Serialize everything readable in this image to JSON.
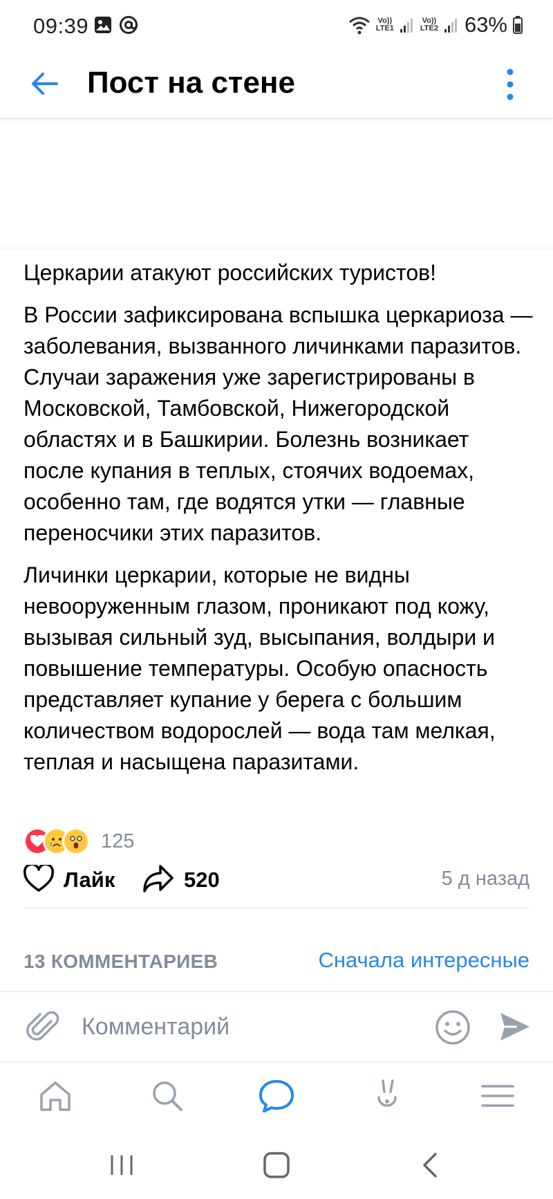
{
  "status_bar": {
    "time": "09:39",
    "icons": [
      "image-icon",
      "at-icon",
      "wifi-icon",
      "signal-1-icon",
      "signal-2-icon",
      "battery-icon"
    ],
    "sim1_label_top": "Vo))",
    "sim1_label_bottom": "LTE1",
    "sim2_label_top": "Vo))",
    "sim2_label_bottom": "LTE2",
    "battery": "63%"
  },
  "header": {
    "title": "Пост на стене"
  },
  "post": {
    "paragraphs": [
      "Церкарии атакуют российских туристов!",
      "В России зафиксирована вспышка церкариоза — заболевания, вызванного личинками паразитов. Случаи заражения уже зарегистрированы в Московской, Тамбовской, Нижегородской областях и в Башкирии. Болезнь возникает после купания в теплых, стоячих водоемах, особенно там, где водятся утки — главные переносчики этих паразитов.",
      "Личинки церкарии, которые не видны невооруженным глазом, проникают под кожу, вызывая сильный зуд, высыпания, волдыри и повышение температуры. Особую опасность представляет купание у берега с большим количеством водорослей — вода там мелкая, теплая и насыщена паразитами."
    ],
    "reactions": {
      "icons": [
        "heart-reaction-icon",
        "crying-reaction-icon",
        "shocked-reaction-icon"
      ],
      "count": "125"
    },
    "like_label": "Лайк",
    "share_count": "520",
    "time": "5 д назад"
  },
  "comments": {
    "count_label": "13 КОММЕНТАРИЕВ",
    "sort_label": "Сначала интересные",
    "input_placeholder": "Комментарий"
  },
  "bottom_nav": {
    "items": [
      "home-icon",
      "search-icon",
      "messages-icon",
      "clips-icon",
      "menu-icon"
    ],
    "active": "messages-icon"
  },
  "colors": {
    "accent": "#2688eb",
    "icon_gray": "#99a2ad",
    "secondary_text": "#818c99"
  }
}
